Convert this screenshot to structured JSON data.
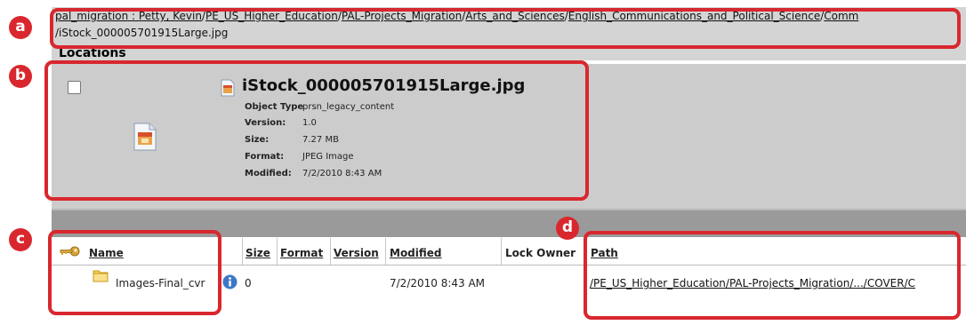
{
  "breadcrumb": {
    "line1": [
      "pal_migration : Petty, Kevin",
      "PE_US_Higher_Education",
      "PAL-Projects_Migration",
      "Arts_and_Sciences",
      "English_Communications_and_Political_Science",
      "Comm"
    ],
    "separator": "/",
    "line2": "/iStock_000005701915Large.jpg"
  },
  "section_title": "Locations",
  "file": {
    "name": "iStock_000005701915Large.jpg",
    "properties": [
      {
        "label": "Object Type",
        "value": "prsn_legacy_content"
      },
      {
        "label": "Version:",
        "value": "1.0"
      },
      {
        "label": "Size:",
        "value": "7.27 MB"
      },
      {
        "label": "Format:",
        "value": "JPEG Image"
      },
      {
        "label": "Modified:",
        "value": "7/2/2010 8:43 AM"
      }
    ]
  },
  "table": {
    "columns": {
      "name": "Name",
      "size": "Size",
      "format": "Format",
      "version": "Version",
      "modified": "Modified",
      "lock_owner": "Lock Owner",
      "path": "Path"
    },
    "rows": [
      {
        "name": "Images-Final_cvr",
        "size": "0",
        "modified": "7/2/2010 8:43 AM",
        "path": "/PE_US_Higher_Education/PAL-Projects_Migration/.../COVER/C"
      }
    ]
  },
  "annotations": [
    "a",
    "b",
    "c",
    "d"
  ],
  "colors": {
    "annotation": "#d9272e",
    "panel": "#cccccc",
    "band": "#9a9a9a"
  },
  "icons": [
    "checkbox",
    "image-file-icon",
    "key-icon",
    "folder-icon",
    "info-icon"
  ]
}
